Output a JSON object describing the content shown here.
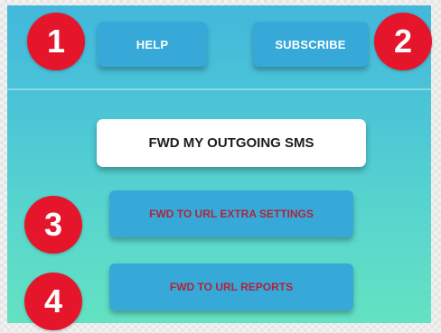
{
  "header": {
    "help_label": "HELP",
    "subscribe_label": "SUBSCRIBE"
  },
  "main": {
    "outgoing_label": "FWD MY OUTGOING SMS",
    "extra_settings_label": "FWD TO URL EXTRA SETTINGS",
    "reports_label": "FWD TO URL REPORTS"
  },
  "annotations": {
    "badge_1": "1",
    "badge_2": "2",
    "badge_3": "3",
    "badge_4": "4"
  },
  "colors": {
    "badge": "#e5162c",
    "button_blue": "#37a9d8",
    "red_text": "#b0243b",
    "background_top": "#43b8dc",
    "background_bottom": "#63e2c2"
  }
}
